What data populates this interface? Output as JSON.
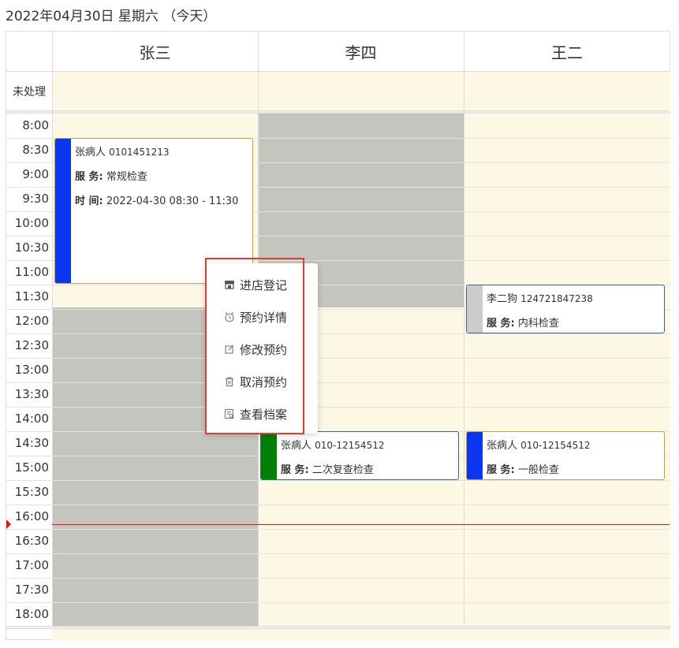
{
  "date_title": "2022年04月30日 星期六 （今天）",
  "columns": [
    {
      "name": "张三"
    },
    {
      "name": "李四"
    },
    {
      "name": "王二"
    }
  ],
  "allday_label": "未处理",
  "time_slots": [
    "8:00",
    "8:30",
    "9:00",
    "9:30",
    "10:00",
    "10:30",
    "11:00",
    "11:30",
    "12:00",
    "12:30",
    "13:00",
    "13:30",
    "14:00",
    "14:30",
    "15:00",
    "15:30",
    "16:00",
    "16:30",
    "17:00",
    "17:30",
    "18:00"
  ],
  "events": [
    {
      "name": "张病人",
      "phone": "0101451213",
      "service_label": "服 务:",
      "service": "常规检查",
      "time_label": "时 间:",
      "time": "2022-04-30 08:30 - 11:30",
      "stripe_color": "#0b36f0",
      "border_color": "#c8a040"
    },
    {
      "name": "张病人",
      "phone": "010-12154512",
      "service_label": "服 务:",
      "service": "二次复查检查",
      "stripe_color": "#008000",
      "border_color": "#2e6b8a"
    },
    {
      "name": "李二狗",
      "phone": "124721847238",
      "service_label": "服 务:",
      "service": "内科检查",
      "stripe_color": "#cccccc",
      "border_color": "#2e6b8a"
    },
    {
      "name": "张病人",
      "phone": "010-12154512",
      "service_label": "服 务:",
      "service": "一般检查",
      "stripe_color": "#0b36f0",
      "border_color": "#c8a040"
    }
  ],
  "context_menu": {
    "items": [
      {
        "label": "进店登记",
        "icon": "store-icon"
      },
      {
        "label": "预约详情",
        "icon": "alarm-clock-icon"
      },
      {
        "label": "修改预约",
        "icon": "edit-icon"
      },
      {
        "label": "取消预约",
        "icon": "trash-icon"
      },
      {
        "label": "查看档案",
        "icon": "file-search-icon"
      }
    ]
  },
  "colors": {
    "business_bg": "#fcf8e3",
    "non_business_bg": "#c3c5be",
    "now_indicator": "#e11111",
    "highlight_border": "#e53935"
  }
}
